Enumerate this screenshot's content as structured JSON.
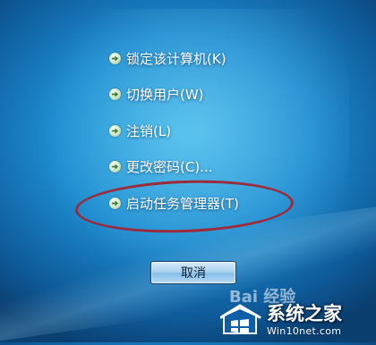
{
  "menu": {
    "items": [
      {
        "label": "锁定该计算机(K)"
      },
      {
        "label": "切换用户(W)"
      },
      {
        "label": "注销(L)"
      },
      {
        "label": "更改密码(C)..."
      },
      {
        "label": "启动任务管理器(T)"
      }
    ]
  },
  "cancel_button": {
    "label": "取消"
  },
  "watermark": {
    "baidu_text": "Bai 经验",
    "site_name": "系统之家",
    "site_url": "Win10net.com"
  },
  "colors": {
    "background": "#1d8cd0",
    "highlight_circle": "#9b2a3b",
    "button": "#a9d1ef"
  },
  "icons": {
    "menu_arrow": "arrow-right-icon",
    "logo": "site-logo-icon"
  }
}
